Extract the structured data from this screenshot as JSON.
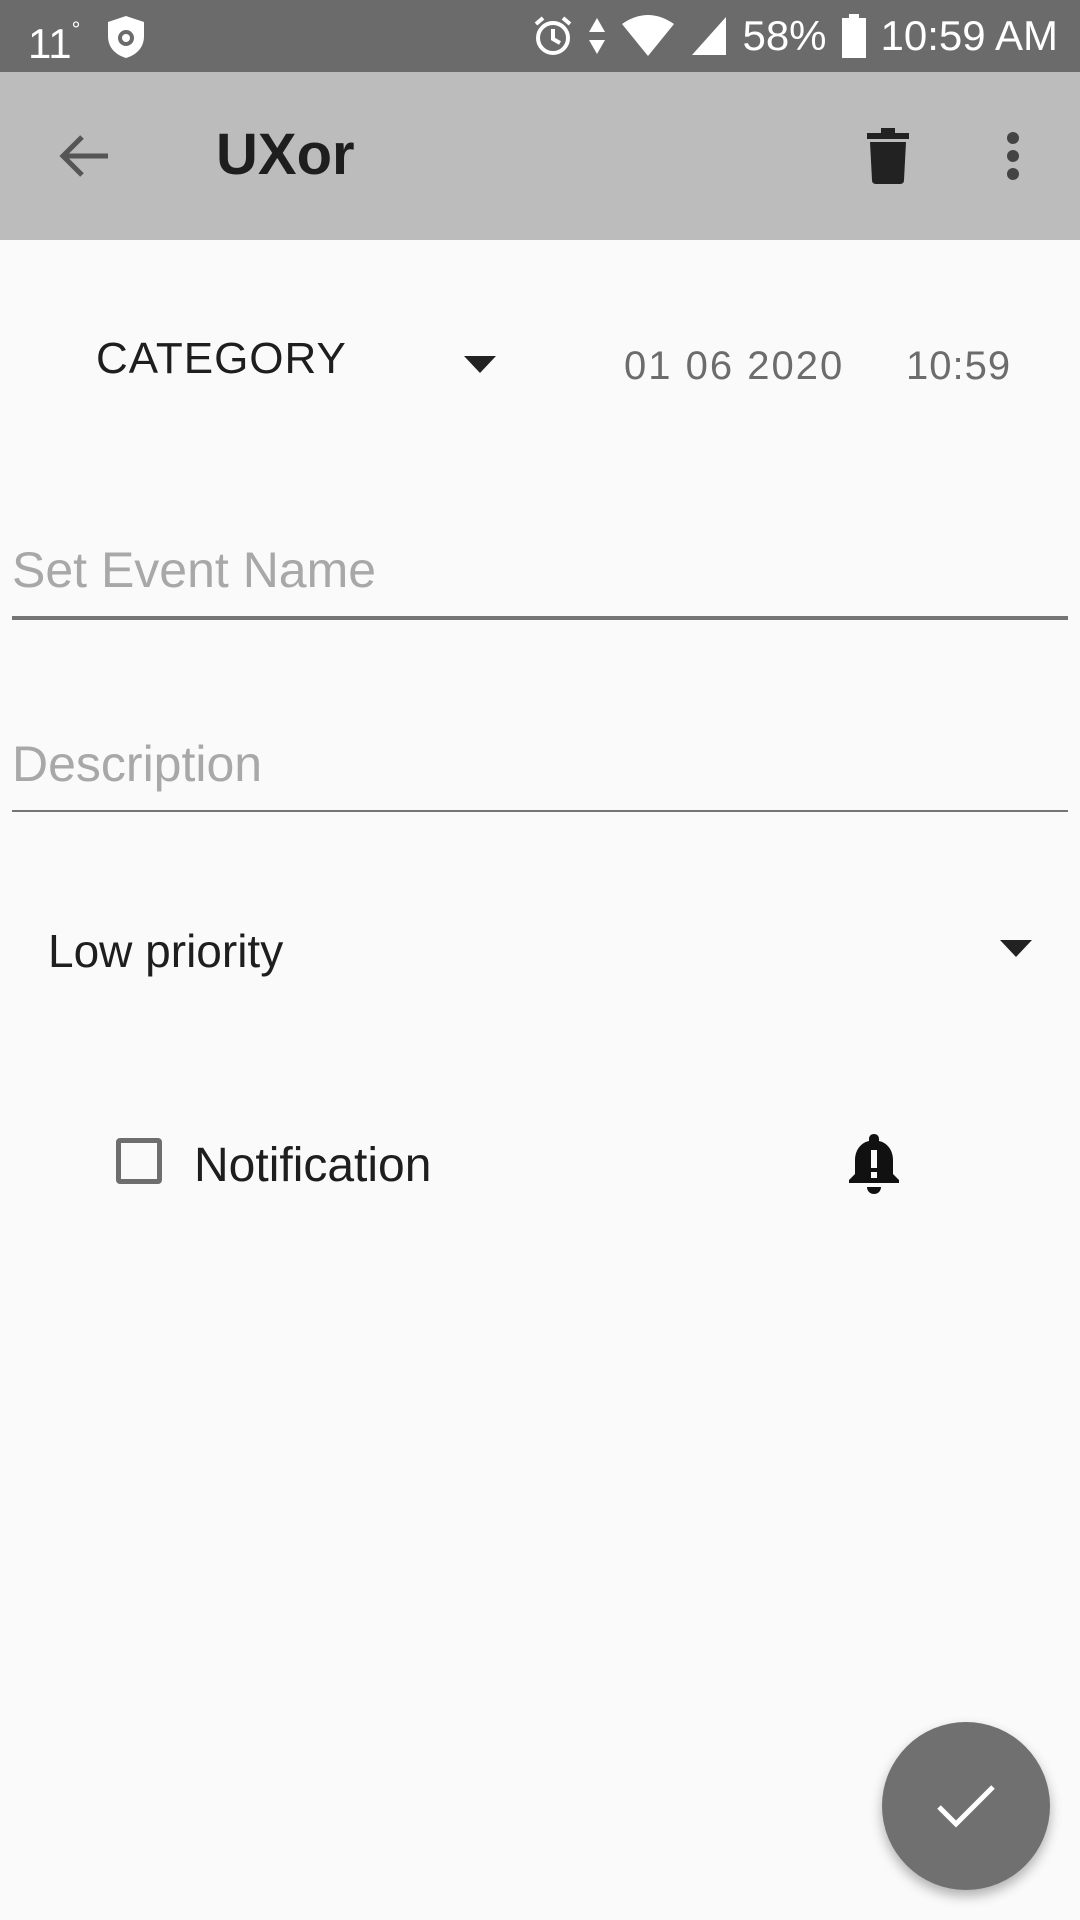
{
  "status_bar": {
    "temperature": "11",
    "degree_symbol": "°",
    "battery_percent": "58%",
    "time": "10:59 AM"
  },
  "app_bar": {
    "title": "UXor",
    "icons": [
      "back-arrow-icon",
      "delete-icon",
      "more-vert-icon"
    ]
  },
  "form": {
    "category": {
      "selected": "CATEGORY"
    },
    "date": "01 06 2020",
    "time": "10:59",
    "event_name": {
      "value": "",
      "placeholder": "Set Event Name"
    },
    "description": {
      "value": "",
      "placeholder": "Description"
    },
    "priority": {
      "selected": "Low priority"
    },
    "notification": {
      "label": "Notification",
      "checked": false
    }
  },
  "fab": {
    "icon": "check-icon"
  },
  "colors": {
    "status_bar": "#6b6b6b",
    "app_bar": "#bcbcbc",
    "background": "#fafafa",
    "fab": "#707070"
  }
}
